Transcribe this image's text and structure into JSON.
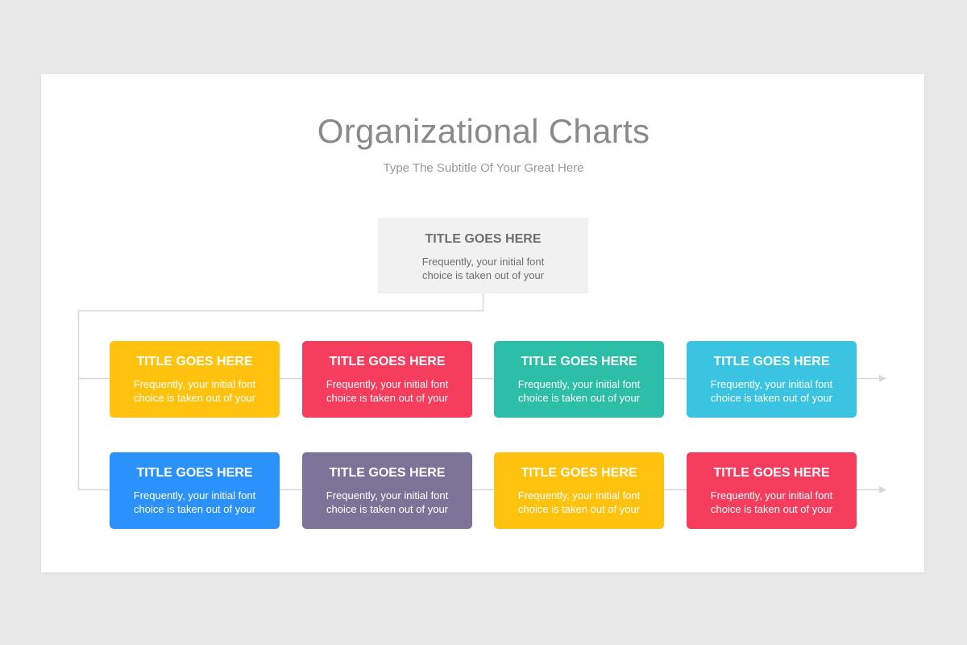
{
  "slide": {
    "title": "Organizational Charts",
    "subtitle": "Type The Subtitle Of Your Great Here"
  },
  "root": {
    "title": "TITLE GOES HERE",
    "text": "Frequently, your initial font choice is taken out of your",
    "color": "#f1f1f1"
  },
  "row1": [
    {
      "title": "TITLE GOES HERE",
      "text": "Frequently, your initial font choice is taken out of your",
      "color": "#ffc20e"
    },
    {
      "title": "TITLE GOES HERE",
      "text": "Frequently, your initial font choice is taken out of your",
      "color": "#f73d5d"
    },
    {
      "title": "TITLE GOES HERE",
      "text": "Frequently, your initial font choice is taken out of your",
      "color": "#2dbea8"
    },
    {
      "title": "TITLE GOES HERE",
      "text": "Frequently, your initial font choice is taken out of your",
      "color": "#3bc4e2"
    }
  ],
  "row2": [
    {
      "title": "TITLE GOES HERE",
      "text": "Frequently, your initial font choice is taken out of your",
      "color": "#2b92fb"
    },
    {
      "title": "TITLE GOES HERE",
      "text": "Frequently, your initial font choice is taken out of your",
      "color": "#7c7498"
    },
    {
      "title": "TITLE GOES HERE",
      "text": "Frequently, your initial font choice is taken out of your",
      "color": "#ffc20e"
    },
    {
      "title": "TITLE GOES HERE",
      "text": "Frequently, your initial font choice is taken out of your",
      "color": "#f73d5d"
    }
  ],
  "colors": {
    "connector": "#d7d7d7",
    "title_text": "#8a8a8a",
    "subtitle_text": "#9a9a9a",
    "background": "#e9e8e9",
    "slide": "#ffffff"
  }
}
